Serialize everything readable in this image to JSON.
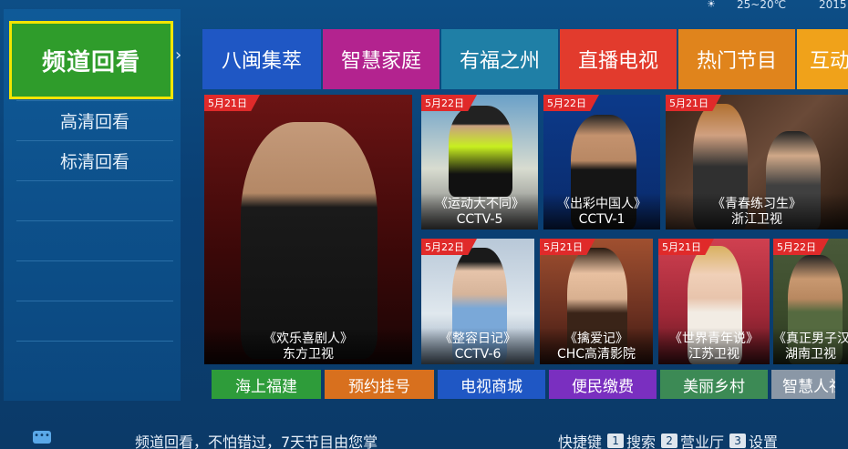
{
  "status": {
    "weather": "25~20℃",
    "year": "2015",
    "weather_icon": "sun-icon"
  },
  "sidebar": {
    "title": "频道回看",
    "items": [
      {
        "label": "高清回看"
      },
      {
        "label": "标清回看"
      }
    ]
  },
  "tabs": [
    {
      "label": "八闽集萃",
      "color": "#1f57c4"
    },
    {
      "label": "智慧家庭",
      "color": "#b3238f"
    },
    {
      "label": "有福之州",
      "color": "#1f7fa6"
    },
    {
      "label": "直播电视",
      "color": "#e23b2d"
    },
    {
      "label": "热门节目",
      "color": "#e0841c"
    },
    {
      "label": "互动",
      "color": "#f0a21a"
    }
  ],
  "tiles": [
    {
      "date": "5月21日",
      "title": "《欢乐喜剧人》",
      "channel": "东方卫视"
    },
    {
      "date": "5月22日",
      "title": "《运动大不同》",
      "channel": "CCTV-5"
    },
    {
      "date": "5月22日",
      "title": "《出彩中国人》",
      "channel": "CCTV-1"
    },
    {
      "date": "5月21日",
      "title": "《青春练习生》",
      "channel": "浙江卫视"
    },
    {
      "date": "5月22日",
      "title": "《整容日记》",
      "channel": "CCTV-6"
    },
    {
      "date": "5月21日",
      "title": "《擒爱记》",
      "channel": "CHC高清影院"
    },
    {
      "date": "5月21日",
      "title": "《世界青年说》",
      "channel": "江苏卫视"
    },
    {
      "date": "5月22日",
      "title": "《真正男子汉》",
      "channel": "湖南卫视"
    }
  ],
  "buttons": [
    {
      "label": "海上福建",
      "color": "#2e9c3a"
    },
    {
      "label": "预约挂号",
      "color": "#d8701e"
    },
    {
      "label": "电视商城",
      "color": "#1f57c4"
    },
    {
      "label": "便民缴费",
      "color": "#7a2fc0"
    },
    {
      "label": "美丽乡村",
      "color": "#3c8a55"
    },
    {
      "label": "智慧人社",
      "color": "#8a97a6"
    }
  ],
  "footer": {
    "message": "频道回看，不怕错过，7天节目由您掌",
    "shortcut_label": "快捷键",
    "shortcuts": [
      {
        "key": "1",
        "label": "搜索"
      },
      {
        "key": "2",
        "label": "营业厅"
      },
      {
        "key": "3",
        "label": "设置"
      }
    ]
  }
}
